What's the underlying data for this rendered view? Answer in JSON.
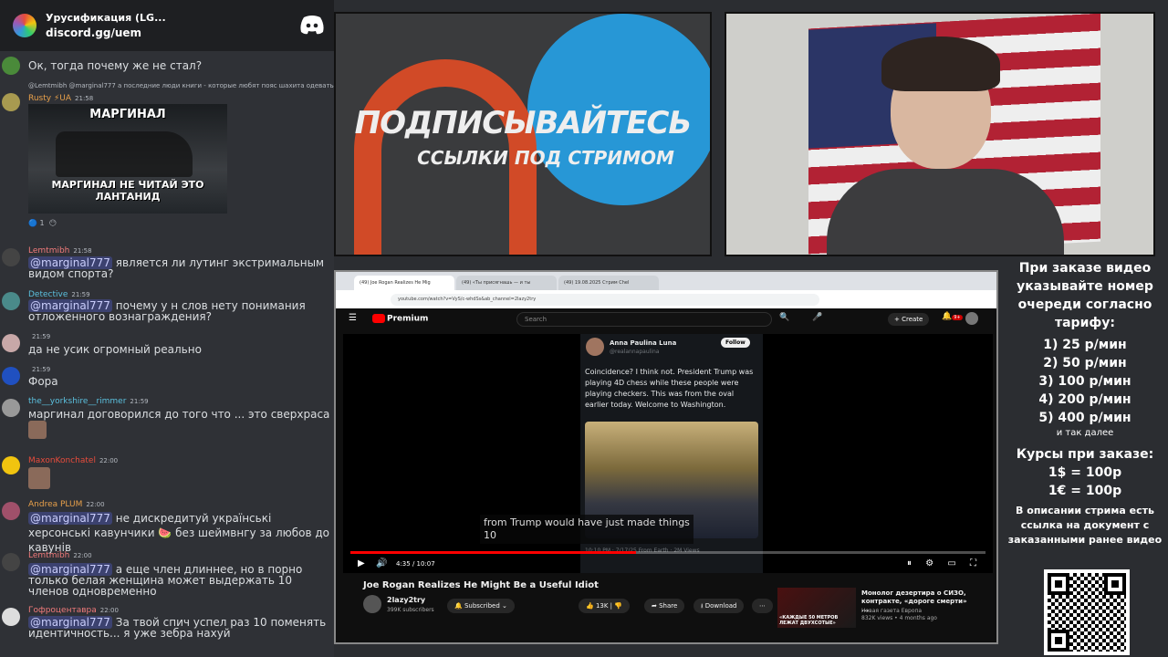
{
  "discord": {
    "server_name": "Урусификация (LG...",
    "invite": "discord.gg/uem",
    "messages": [
      {
        "user": "",
        "time": "",
        "text": "Ок, тогда почему же не стал?",
        "mention": ""
      },
      {
        "user": "Rusty ⚡UA",
        "time": "21:58",
        "reply": "@Lemtmibh @marginal777 а последние люди книги - которые любят пояс шахита одевать, то",
        "text": "",
        "mention": ""
      },
      {
        "user": "Lemtmibh",
        "time": "21:58",
        "text": "является ли лутинг экстримальным видом спорта?",
        "mention": "@marginal777"
      },
      {
        "user": "Detective",
        "time": "21:59",
        "text": "почему у н слов нету понимания отложенного вознаграждения?",
        "mention": "@marginal777"
      },
      {
        "user": "",
        "time": "21:59",
        "text": "да не усик огромный реально",
        "mention": ""
      },
      {
        "user": "",
        "time": "21:59",
        "text": "Фора",
        "mention": ""
      },
      {
        "user": "the__yorkshire__rimmer",
        "time": "21:59",
        "text": "маргинал договорился до того что ... это сверхраса",
        "mention": ""
      },
      {
        "user": "MaxonKonchatel",
        "time": "22:00",
        "text": "",
        "mention": ""
      },
      {
        "user": "Andrea PLUM",
        "time": "22:00",
        "text": "не дискредитуй українські херсонські кавунчики 🍉 без шеймвнгу за любов до кавунів",
        "mention": "@marginal777"
      },
      {
        "user": "Lemtmibh",
        "time": "22:00",
        "text": "а еще член длиннее, но в порно только белая женщина может выдержать 10 членов одновременно",
        "mention": "@marginal777"
      },
      {
        "user": "Гофроцентавра",
        "time": "22:00",
        "text": "За твой спич успел раз 10 поменять идентичность... я уже зебра нахуй",
        "mention": "@marginal777"
      }
    ],
    "meme": {
      "line1": "МАРГИНАЛ",
      "line2": "МАРГИНАЛ НЕ ЧИТАЙ ЭТО ЛАНТАНИД"
    },
    "reaction_count": "1"
  },
  "promo": {
    "headline": "ПОДПИСЫВАЙТЕСЬ",
    "subline": "ССЫЛКИ ПОД СТРИМОМ"
  },
  "browser": {
    "tabs": [
      "(49) Joe Rogan Realizes He Mig",
      "(49) «Ты присягнашь — и ты",
      "(49) 19.08.2025 Стрим Chel"
    ],
    "url": "youtube.com/watch?v=VyS/c-whdSs&ab_channel=2lazy2try",
    "yt_logo": "Premium",
    "search_placeholder": "Search",
    "create_label": "Create",
    "notif_count": "9+",
    "tweet": {
      "name": "Anna Paulina Luna",
      "handle": "@realannapaulina",
      "follow": "Follow",
      "text": "Coincidence? I think not. President Trump was playing 4D chess while these people were playing checkers. This was from the oval earlier today. Welcome to Washington.",
      "footer": "10:10 PM · 7/17/25 From Earth · 2M Views"
    },
    "caption": "from Trump would have just made things\n10",
    "time": "4:35 / 10:07",
    "progress": 0.45,
    "video_title": "Joe Rogan Realizes He Might Be a Useful Idiot",
    "channel": "2lazy2try",
    "subs": "399K subscribers",
    "subscribed": "Subscribed",
    "likes": "13K",
    "share": "Share",
    "download": "Download",
    "rec": {
      "title": "Монолог дезертира о СИЗО, контракте, «дороге смерти» ...",
      "channel": "Новая газета Европа",
      "meta": "832K views • 4 months ago",
      "thumb_text": "«КАЖДЫЕ 50 МЕТРОВ ЛЕЖАТ ДВУХСОТЫЕ»"
    }
  },
  "info": {
    "intro": "При заказе видео указывайте номер очереди согласно тарифу:",
    "tariffs": [
      "1) 25 р/мин",
      "2) 50 р/мин",
      "3) 100 р/мин",
      "4) 200 р/мин",
      "5) 400 р/мин"
    ],
    "etc": "и так далее",
    "rates_title": "Курсы при заказе:",
    "rates": [
      "1$ = 100р",
      "1€ = 100р"
    ],
    "desc": "В описании стрима есть ссылка на документ с заказанными ранее видео"
  },
  "colors": {
    "discord_bg": "#2f3136",
    "mention_bg": "#3c4270",
    "yt_red": "#ff0000",
    "telegram": "#2797d6"
  }
}
